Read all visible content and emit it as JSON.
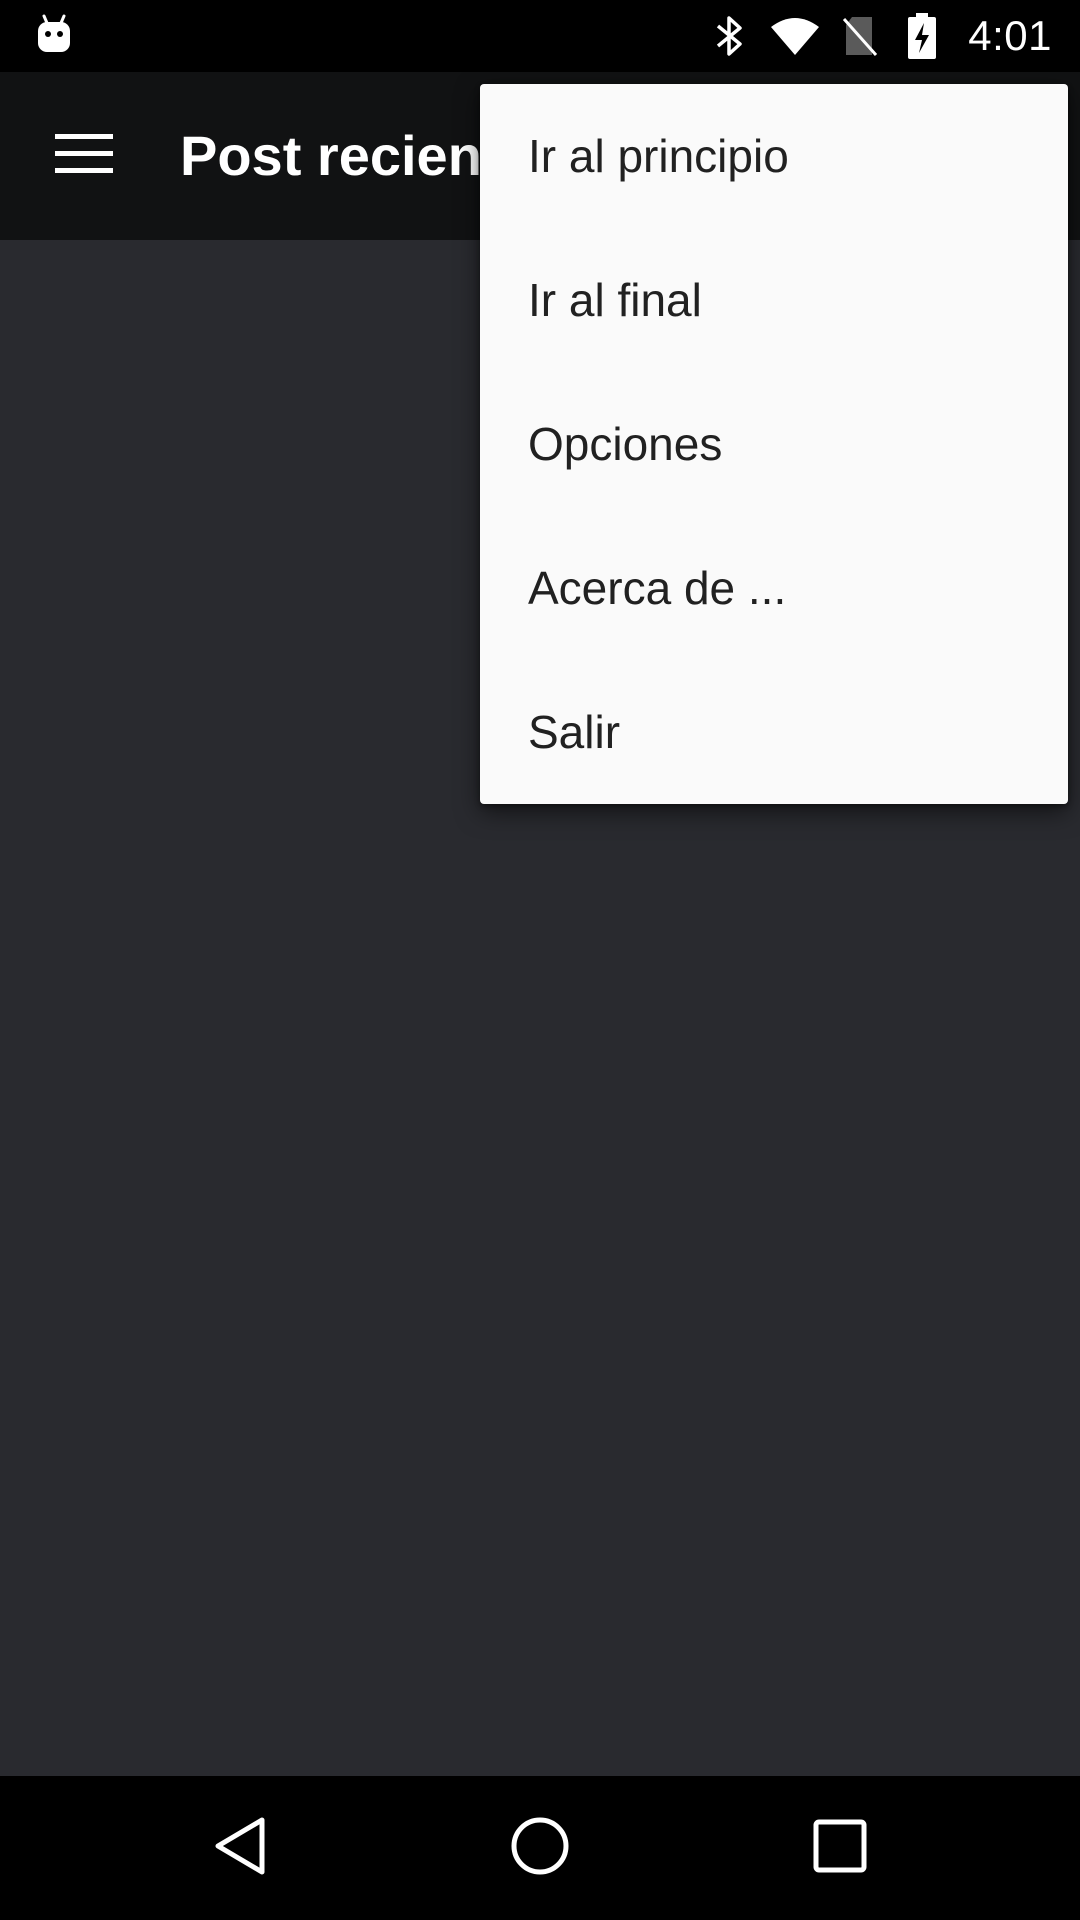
{
  "status_bar": {
    "time": "4:01",
    "icons": [
      "android-notification-icon",
      "bluetooth-icon",
      "wifi-icon",
      "no-sim-icon",
      "battery-charging-icon"
    ]
  },
  "app_bar": {
    "title": "Post recien",
    "menu_icon": "hamburger-menu-icon"
  },
  "overflow_menu": {
    "items": [
      {
        "label": "Ir al principio"
      },
      {
        "label": "Ir al final"
      },
      {
        "label": "Opciones"
      },
      {
        "label": "Acerca de ..."
      },
      {
        "label": "Salir"
      }
    ]
  },
  "nav_bar": {
    "icons": [
      "back-icon",
      "home-icon",
      "recents-icon"
    ]
  },
  "colors": {
    "status_bar_bg": "#000000",
    "app_bar_bg": "#111213",
    "content_bg": "#292a2f",
    "menu_bg": "#fafafa",
    "menu_text": "#212121",
    "nav_bar_bg": "#000000"
  }
}
